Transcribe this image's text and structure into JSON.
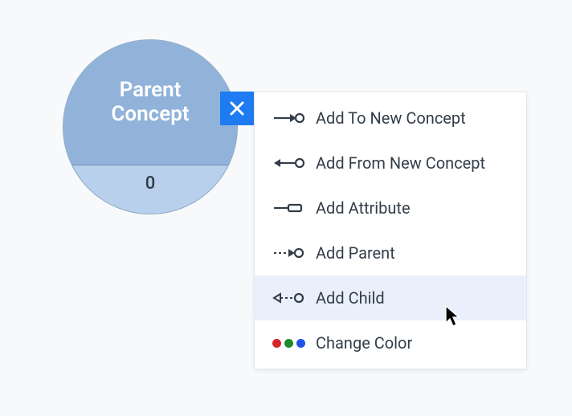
{
  "node": {
    "title": "Parent Concept",
    "child_count": "0"
  },
  "close_label": "Close",
  "menu": {
    "items": [
      {
        "label": "Add To New Concept"
      },
      {
        "label": "Add From New Concept"
      },
      {
        "label": "Add Attribute"
      },
      {
        "label": "Add Parent"
      },
      {
        "label": "Add Child"
      },
      {
        "label": "Change Color"
      }
    ],
    "hover_index": 4
  }
}
